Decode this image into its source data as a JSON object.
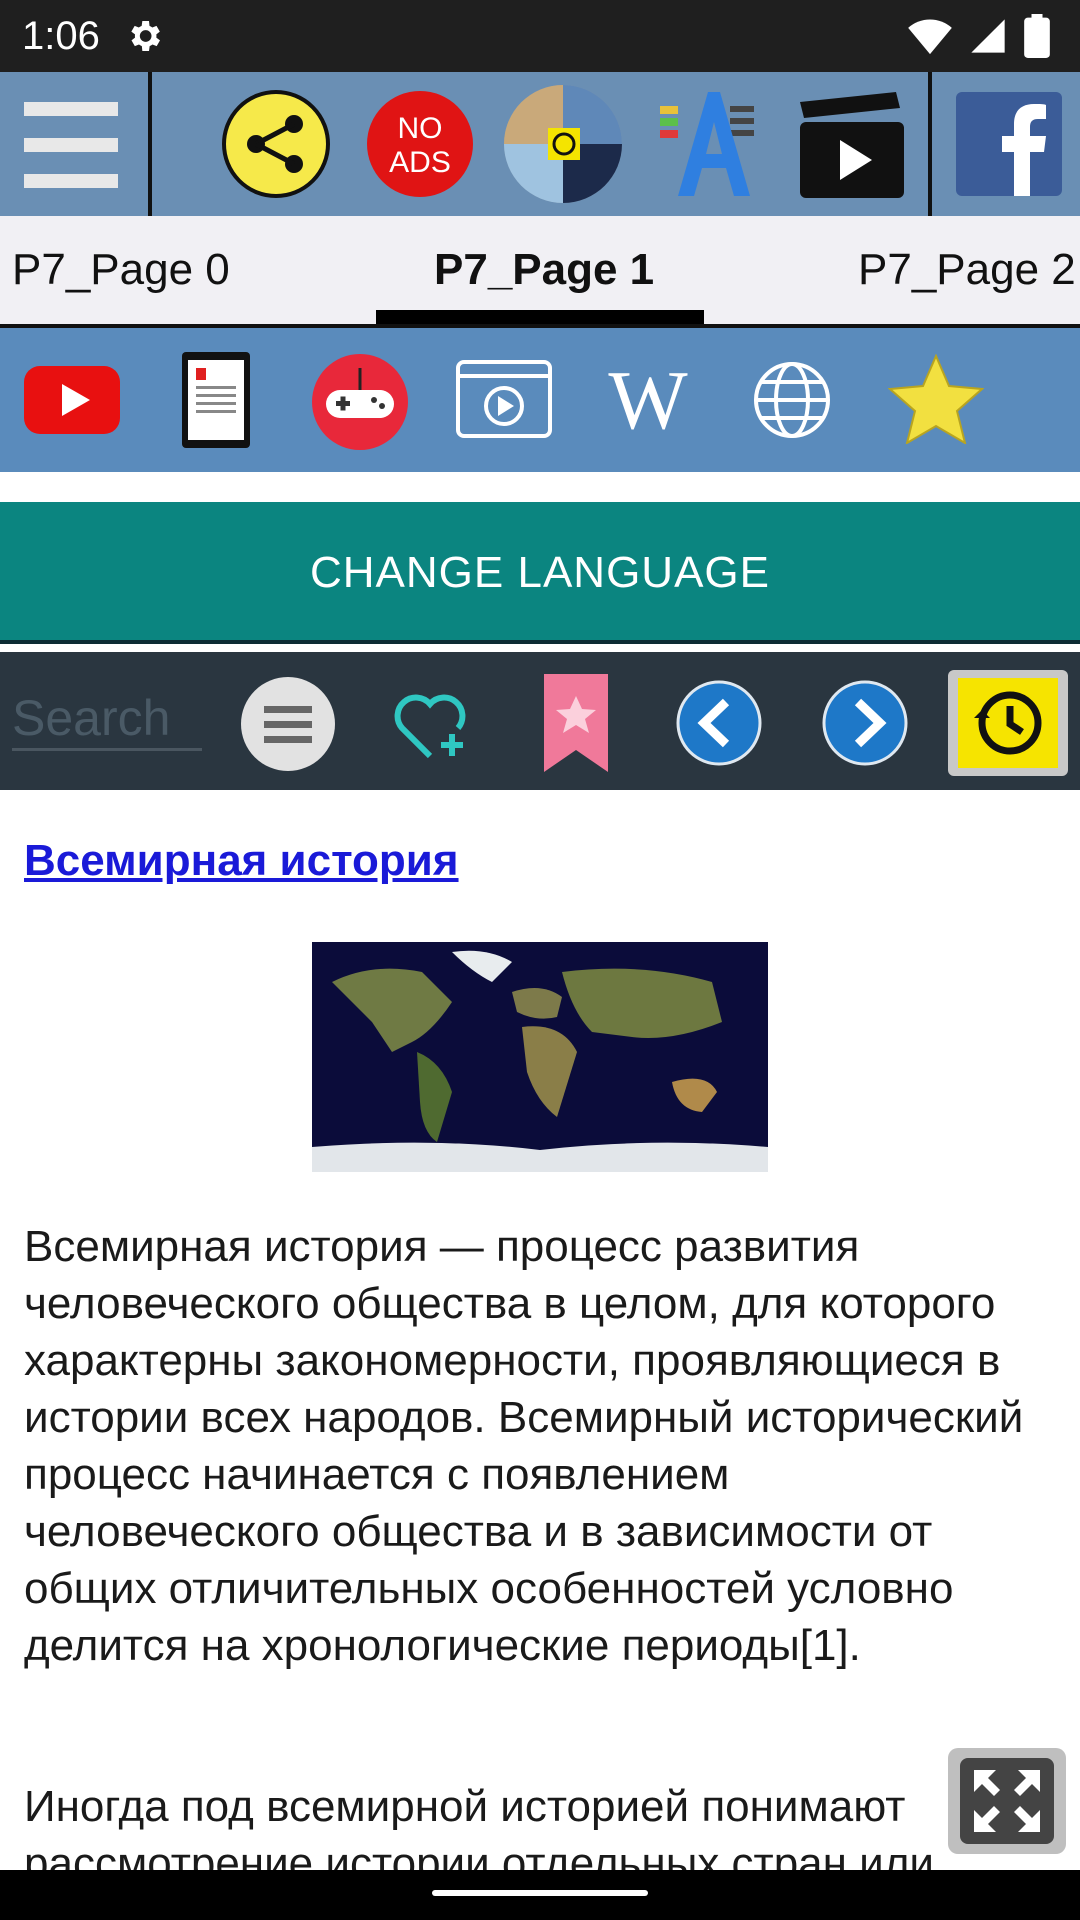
{
  "status_bar": {
    "time": "1:06",
    "icons": [
      "settings-gear-icon",
      "wifi-icon",
      "signal-icon",
      "battery-icon"
    ]
  },
  "top_toolbar": {
    "items": [
      "menu-icon",
      "share-icon",
      "no-ads-icon",
      "history-world-icon",
      "font-size-icon",
      "video-clapper-icon",
      "facebook-icon"
    ],
    "no_ads_line1": "NO",
    "no_ads_line2": "ADS"
  },
  "tabs": [
    {
      "label": "P7_Page 0",
      "selected": false
    },
    {
      "label": "P7_Page 1",
      "selected": true
    },
    {
      "label": "P7_Page 2",
      "selected": false
    }
  ],
  "quick_links": [
    "youtube-icon",
    "ebook-reader-icon",
    "gamepad-icon",
    "video-player-icon",
    "wikipedia-icon",
    "globe-icon",
    "star-icon"
  ],
  "quick_links_wiki_letter": "W",
  "change_language": {
    "label": "CHANGE LANGUAGE"
  },
  "search_bar": {
    "placeholder": "Search",
    "buttons": [
      "list-menu-icon",
      "heart-add-icon",
      "bookmark-star-icon",
      "back-arrow-icon",
      "forward-arrow-icon",
      "history-icon"
    ]
  },
  "article": {
    "title": "Всемирная история",
    "image": "world-map-image",
    "paragraph1": "Всемирная история — процесс развития человеческого общества в целом, для которого характерны закономерности, проявляющиеся в истории всех народов. Всемирный исторический процесс начинается с появлением человеческого общества и в зависимости от общих отличительных особенностей условно делится на хронологические периоды[1].",
    "paragraph2": "Иногда под всемирной историей понимают рассмотрение истории отдельных стран или"
  },
  "colors": {
    "status_bg": "#1f1f1f",
    "toolbar_bg": "#6a8fb4",
    "quickbar_bg": "#5a8bbc",
    "language_btn_bg": "#0b8580",
    "search_bar_bg": "#2a3640",
    "link_color": "#1a1ad8"
  }
}
